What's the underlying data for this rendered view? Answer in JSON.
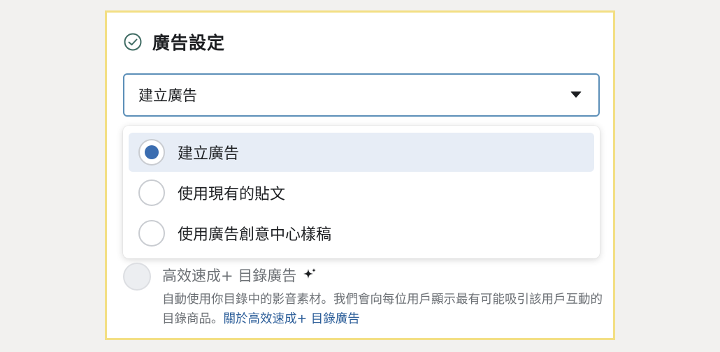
{
  "section": {
    "title": "廣告設定",
    "check_icon": "check-circle-icon"
  },
  "select": {
    "value": "建立廣告",
    "caret_icon": "caret-down-icon"
  },
  "menu": {
    "options": [
      {
        "label": "建立廣告",
        "selected": true
      },
      {
        "label": "使用現有的貼文",
        "selected": false
      },
      {
        "label": "使用廣告創意中心樣稿",
        "selected": false
      }
    ]
  },
  "catalog_option": {
    "title": "高效速成+ 目錄廣告",
    "sparkle_icon": "sparkle-icon",
    "description": "自動使用你目錄中的影音素材。我們會向每位用戶顯示最有可能吸引該用戶互動的目錄商品。",
    "link_text": "關於高效速成+ 目錄廣告"
  },
  "colors": {
    "frame_border": "#f3df84",
    "select_border": "#5c8fb8",
    "selected_bg": "#e7edf6",
    "radio_dot": "#3b6db0",
    "link": "#2a5c98"
  }
}
